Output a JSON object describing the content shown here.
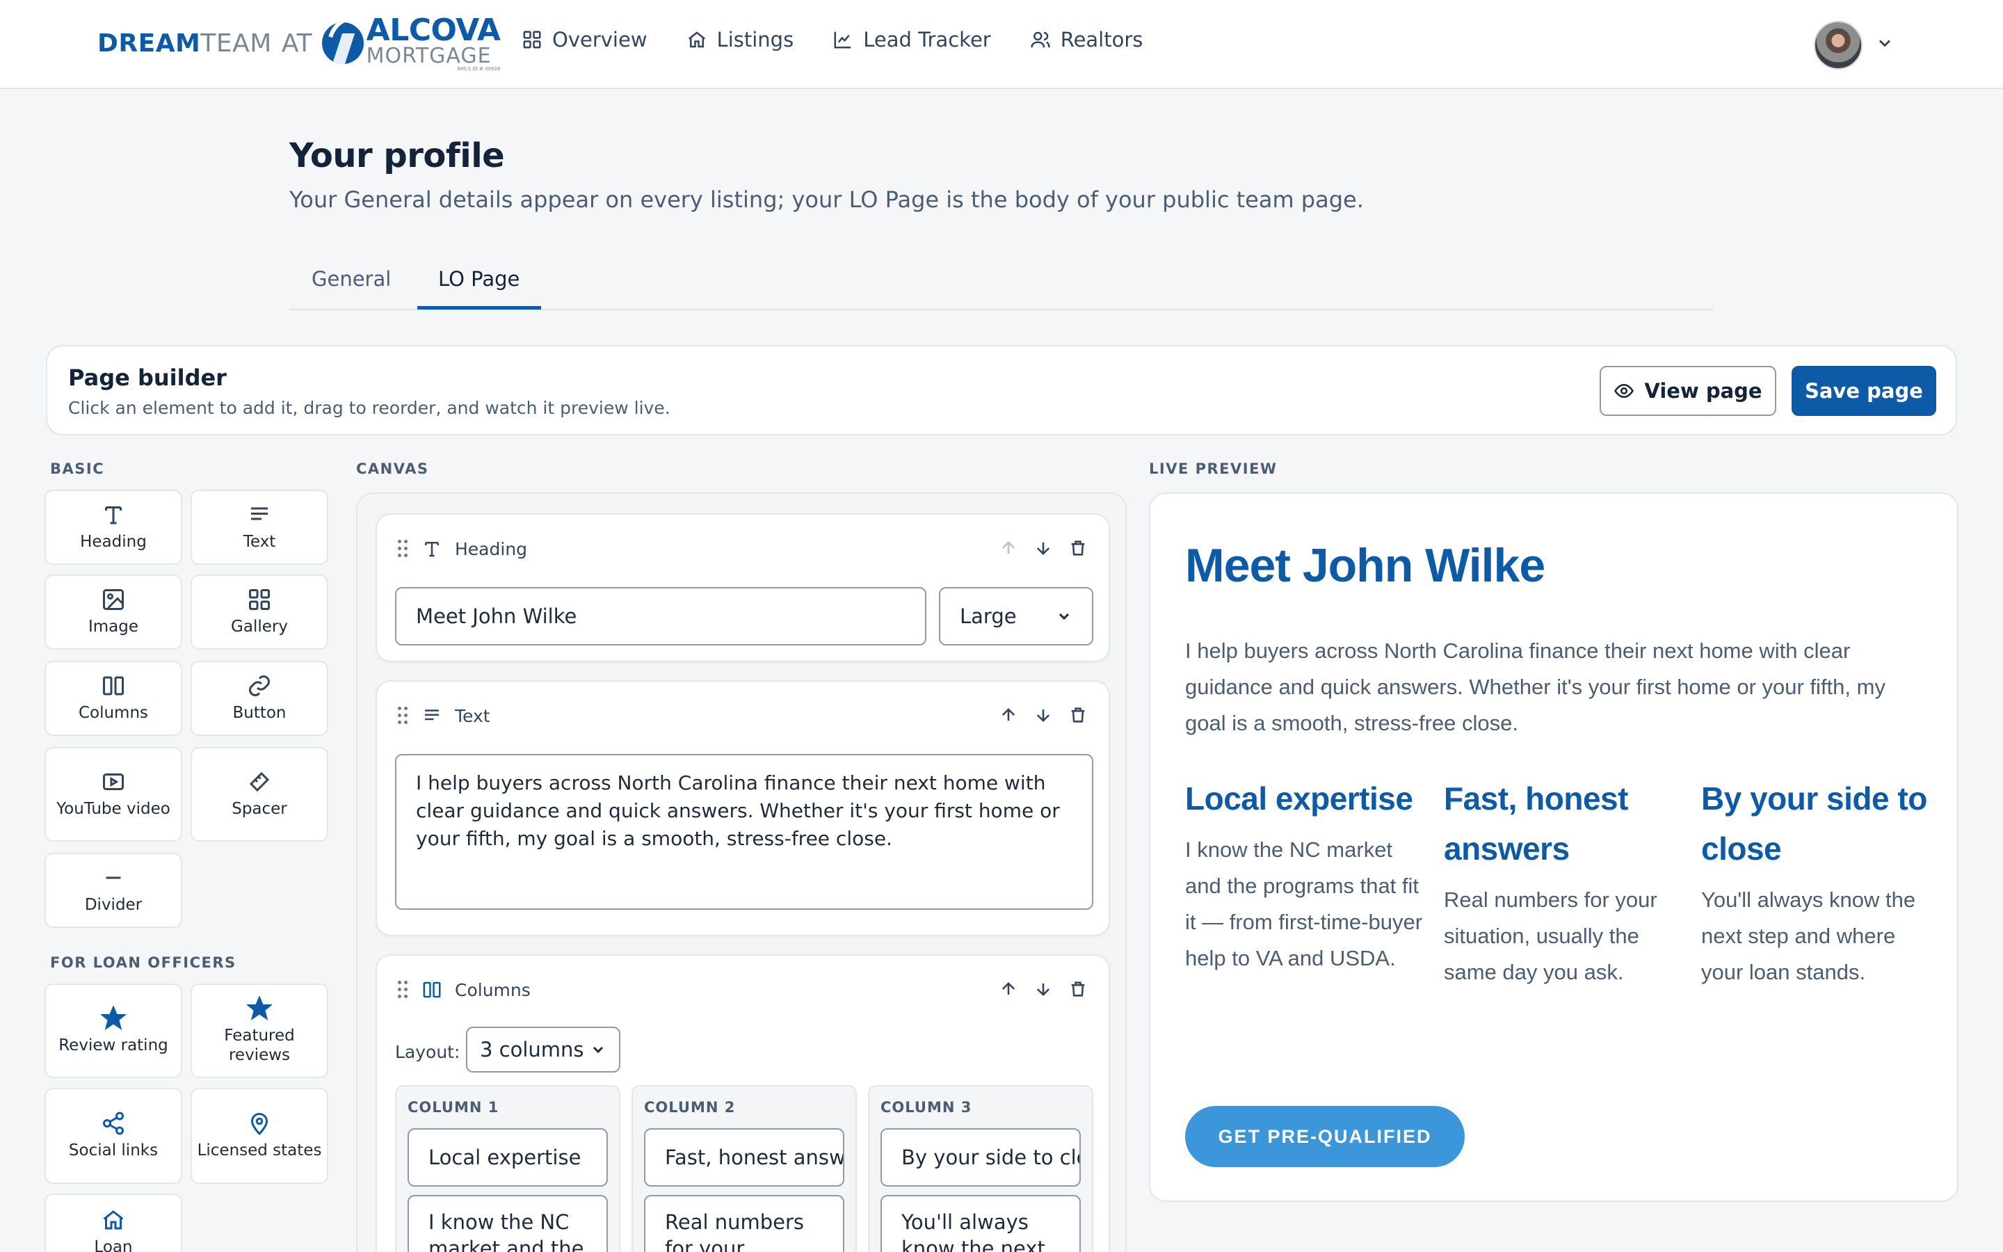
{
  "header": {
    "logo": {
      "dream": "DREAM",
      "team": "TEAM",
      "at": "AT",
      "alcova": "ALCOVA",
      "mortgage": "MORTGAGE",
      "nmls": "NMLS ID # 40928"
    },
    "nav": [
      {
        "label": "Overview",
        "icon": "grid-icon"
      },
      {
        "label": "Listings",
        "icon": "home-icon"
      },
      {
        "label": "Lead Tracker",
        "icon": "chart-line-icon"
      },
      {
        "label": "Realtors",
        "icon": "users-icon"
      }
    ]
  },
  "page": {
    "title": "Your profile",
    "subtitle": "Your General details appear on every listing; your LO Page is the body of your public team page.",
    "tabs": [
      {
        "label": "General"
      },
      {
        "label": "LO Page"
      }
    ],
    "active_tab": "LO Page"
  },
  "builder": {
    "title": "Page builder",
    "subtitle": "Click an element to add it, drag to reorder, and watch it preview live.",
    "view_label": "View page",
    "save_label": "Save page"
  },
  "palette": {
    "basic_label": "BASIC",
    "basic": [
      {
        "label": "Heading",
        "icon": "heading-icon"
      },
      {
        "label": "Text",
        "icon": "text-lines-icon"
      },
      {
        "label": "Image",
        "icon": "image-icon"
      },
      {
        "label": "Gallery",
        "icon": "gallery-icon"
      },
      {
        "label": "Columns",
        "icon": "columns-icon"
      },
      {
        "label": "Button",
        "icon": "link-icon"
      },
      {
        "label": "YouTube video",
        "icon": "youtube-icon"
      },
      {
        "label": "Spacer",
        "icon": "ruler-icon"
      },
      {
        "label": "Divider",
        "icon": "divider-icon"
      }
    ],
    "lo_label": "FOR LOAN OFFICERS",
    "lo": [
      {
        "label": "Review rating",
        "icon": "star-icon"
      },
      {
        "label": "Featured reviews",
        "icon": "star-icon"
      },
      {
        "label": "Social links",
        "icon": "share-icon"
      },
      {
        "label": "Licensed states",
        "icon": "map-pin-icon"
      },
      {
        "label": "Loan",
        "icon": "home-icon"
      }
    ]
  },
  "canvas": {
    "label": "CANVAS",
    "heading_block": {
      "type_label": "Heading",
      "value": "Meet John Wilke",
      "size": "Large"
    },
    "text_block": {
      "type_label": "Text",
      "value": "I help buyers across North Carolina finance their next home with clear guidance and quick answers. Whether it's your first home or your fifth, my goal is a smooth, stress-free close."
    },
    "columns_block": {
      "type_label": "Columns",
      "layout_label": "Layout:",
      "layout": "3 columns",
      "columns": [
        {
          "title": "COLUMN 1",
          "heading": "Local expertise",
          "body": "I know the NC market and the"
        },
        {
          "title": "COLUMN 2",
          "heading": "Fast, honest answers",
          "body": "Real numbers for your"
        },
        {
          "title": "COLUMN 3",
          "heading": "By your side to close",
          "body": "You'll always know the next"
        }
      ]
    }
  },
  "preview": {
    "label": "LIVE PREVIEW",
    "heading": "Meet John Wilke",
    "paragraph": "I help buyers across North Carolina finance their next home with clear guidance and quick answers. Whether it's your first home or your fifth, my goal is a smooth, stress-free close.",
    "columns": [
      {
        "heading": "Local expertise",
        "body": "I know the NC market and the programs that fit it — from first-time-buyer help to VA and USDA."
      },
      {
        "heading": "Fast, honest answers",
        "body": "Real numbers for your situation, usually the same day you ask."
      },
      {
        "heading": "By your side to close",
        "body": "You'll always know the next step and where your loan stands."
      }
    ],
    "button": "GET PRE-QUALIFIED"
  },
  "colors": {
    "brand": "#0d5aa7",
    "cta": "#3b97d9"
  }
}
